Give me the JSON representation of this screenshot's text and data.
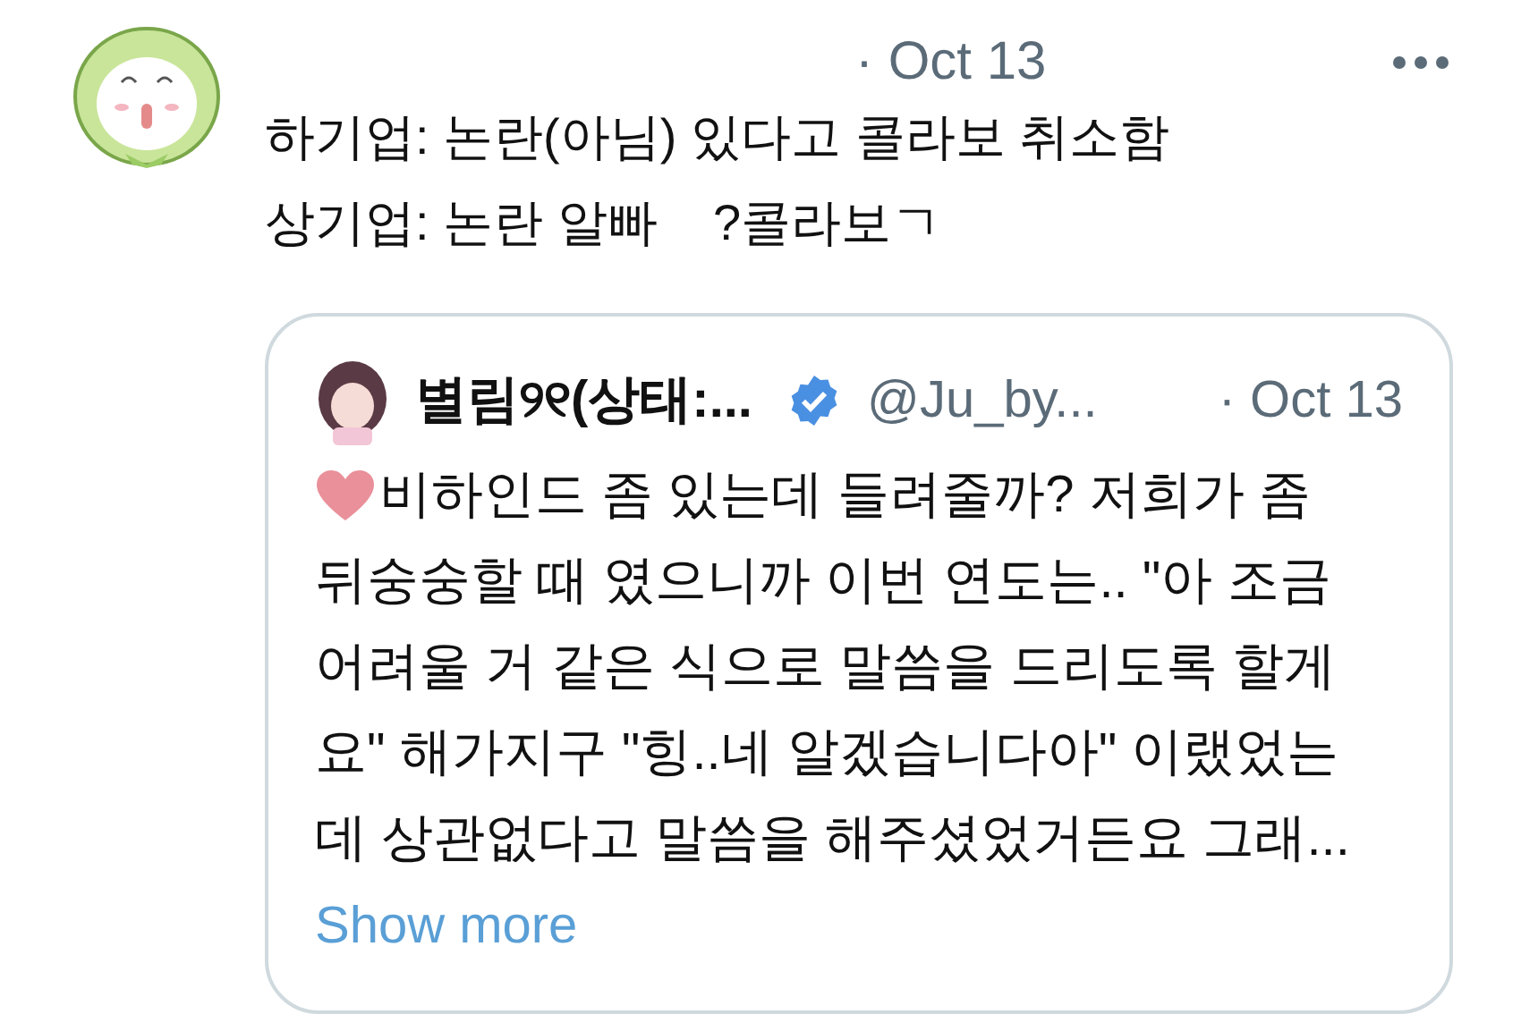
{
  "tweet": {
    "date": "· Oct 13",
    "lines": [
      "하기업: 논란(아님) 있다고 콜라보 취소함",
      "상기업: 논란 알빠    ?콜라보ㄱ"
    ]
  },
  "quote": {
    "name": "별림୨୧(상태:...",
    "verified": true,
    "handle": "@Ju_by...",
    "date": "· Oct 13",
    "lines": [
      "비하인드 좀 있는데 들려줄까? 저희가 좀",
      "뒤숭숭할 때 였으니까 이번 연도는.. \"아 조금",
      "어려울 거 같은 식으로 말씀을 드리도록 할게",
      "요\" 해가지구 \"힝..네 알겠습니다아\" 이랬었는",
      "데 상관없다고 말씀을 해주셨었거든요 그래..."
    ],
    "show_more": "Show more"
  }
}
